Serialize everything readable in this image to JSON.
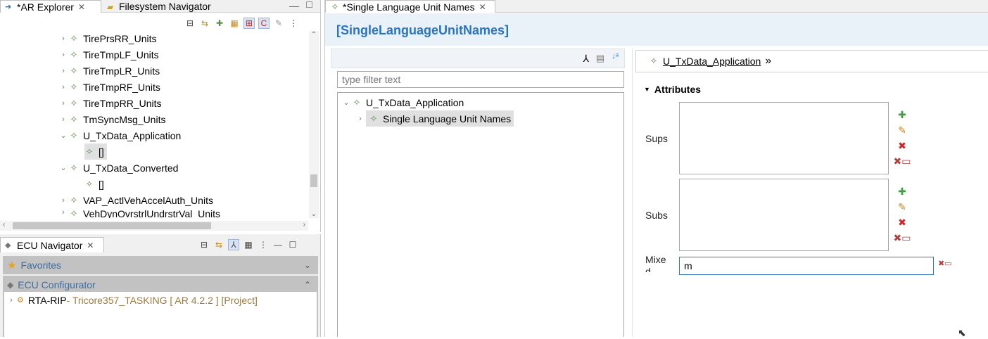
{
  "ar_explorer": {
    "tabs": [
      {
        "label": "*AR Explorer",
        "active": true
      },
      {
        "label": "Filesystem Navigator",
        "active": false
      }
    ],
    "tree": [
      {
        "label": "TirePrsRR_Units",
        "expanded": false,
        "indent": 1
      },
      {
        "label": "TireTmpLF_Units",
        "expanded": false,
        "indent": 1
      },
      {
        "label": "TireTmpLR_Units",
        "expanded": false,
        "indent": 1
      },
      {
        "label": "TireTmpRF_Units",
        "expanded": false,
        "indent": 1
      },
      {
        "label": "TireTmpRR_Units",
        "expanded": false,
        "indent": 1
      },
      {
        "label": "TmSyncMsg_Units",
        "expanded": false,
        "indent": 1
      },
      {
        "label": "U_TxData_Application",
        "expanded": true,
        "indent": 1
      },
      {
        "label": "[]",
        "expanded": null,
        "indent": 2,
        "selected": true
      },
      {
        "label": "U_TxData_Converted",
        "expanded": true,
        "indent": 1
      },
      {
        "label": "[]",
        "expanded": null,
        "indent": 2
      },
      {
        "label": "VAP_ActlVehAccelAuth_Units",
        "expanded": false,
        "indent": 1
      },
      {
        "label": "VehDynOvrstrlUndrstrVal_Units",
        "expanded": false,
        "indent": 1
      }
    ]
  },
  "ecu_navigator": {
    "tab_label": "ECU Navigator",
    "favorites_label": "Favorites",
    "configurator_label": "ECU Configurator",
    "project": {
      "name": "RTA-RIP",
      "detail": " - Tricore357_TASKING [ AR 4.2.2 ] [Project]"
    }
  },
  "editor": {
    "tab_label": "*Single Language Unit Names",
    "title": "[SingleLanguageUnitNames]",
    "filter_placeholder": "type filter text",
    "tree": [
      {
        "label": "U_TxData_Application",
        "expanded": true
      },
      {
        "label": "Single Language Unit Names",
        "expanded": false,
        "selected": true
      }
    ],
    "breadcrumb_label": "U_TxData_Application",
    "attributes_label": "Attributes",
    "sups_label": "Sups",
    "subs_label": "Subs",
    "mixed_label_line1": "Mixe",
    "mixed_label_line2": "d",
    "mixed_value": "m"
  },
  "icons": {
    "tree_node": "gear-icon",
    "expand": "chevron-right-icon",
    "collapse": "chevron-down-icon",
    "add": "plus-icon",
    "edit": "pencil-icon",
    "delete": "delete-icon",
    "clear": "clear-icon"
  },
  "colors": {
    "accent_blue": "#2a73c2",
    "section_gray": "#c2c2c2",
    "node_green": "#5c8a4a"
  }
}
